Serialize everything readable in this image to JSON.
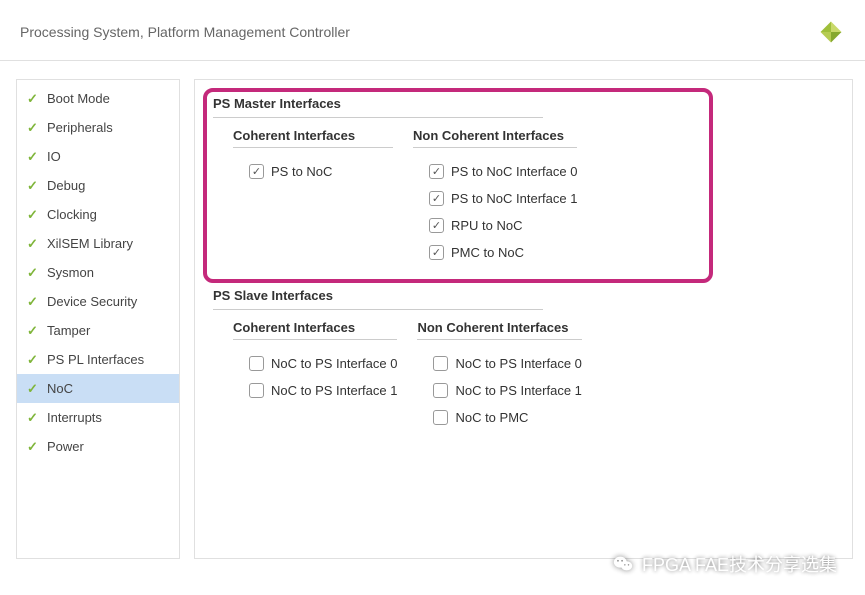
{
  "header": {
    "title": "Processing System, Platform Management Controller"
  },
  "sidebar": {
    "items": [
      {
        "label": "Boot Mode",
        "selected": false
      },
      {
        "label": "Peripherals",
        "selected": false
      },
      {
        "label": "IO",
        "selected": false
      },
      {
        "label": "Debug",
        "selected": false
      },
      {
        "label": "Clocking",
        "selected": false
      },
      {
        "label": "XilSEM Library",
        "selected": false
      },
      {
        "label": "Sysmon",
        "selected": false
      },
      {
        "label": "Device Security",
        "selected": false
      },
      {
        "label": "Tamper",
        "selected": false
      },
      {
        "label": "PS PL Interfaces",
        "selected": false
      },
      {
        "label": "NoC",
        "selected": true
      },
      {
        "label": "Interrupts",
        "selected": false
      },
      {
        "label": "Power",
        "selected": false
      }
    ]
  },
  "main": {
    "master": {
      "title": "PS Master Interfaces",
      "coherent": {
        "title": "Coherent Interfaces",
        "items": [
          {
            "label": "PS to NoC",
            "checked": true
          }
        ]
      },
      "noncoherent": {
        "title": "Non Coherent Interfaces",
        "items": [
          {
            "label": "PS to NoC Interface 0",
            "checked": true
          },
          {
            "label": "PS to NoC Interface 1",
            "checked": true
          },
          {
            "label": "RPU to NoC",
            "checked": true
          },
          {
            "label": "PMC to NoC",
            "checked": true
          }
        ]
      }
    },
    "slave": {
      "title": "PS Slave Interfaces",
      "coherent": {
        "title": "Coherent Interfaces",
        "items": [
          {
            "label": "NoC to PS Interface 0",
            "checked": false
          },
          {
            "label": "NoC to PS Interface 1",
            "checked": false
          }
        ]
      },
      "noncoherent": {
        "title": "Non Coherent Interfaces",
        "items": [
          {
            "label": "NoC to PS Interface 0",
            "checked": false
          },
          {
            "label": "NoC to PS Interface 1",
            "checked": false
          },
          {
            "label": "NoC to PMC",
            "checked": false
          }
        ]
      }
    }
  },
  "watermark": {
    "text": "FPGA FAE技术分享选集"
  }
}
